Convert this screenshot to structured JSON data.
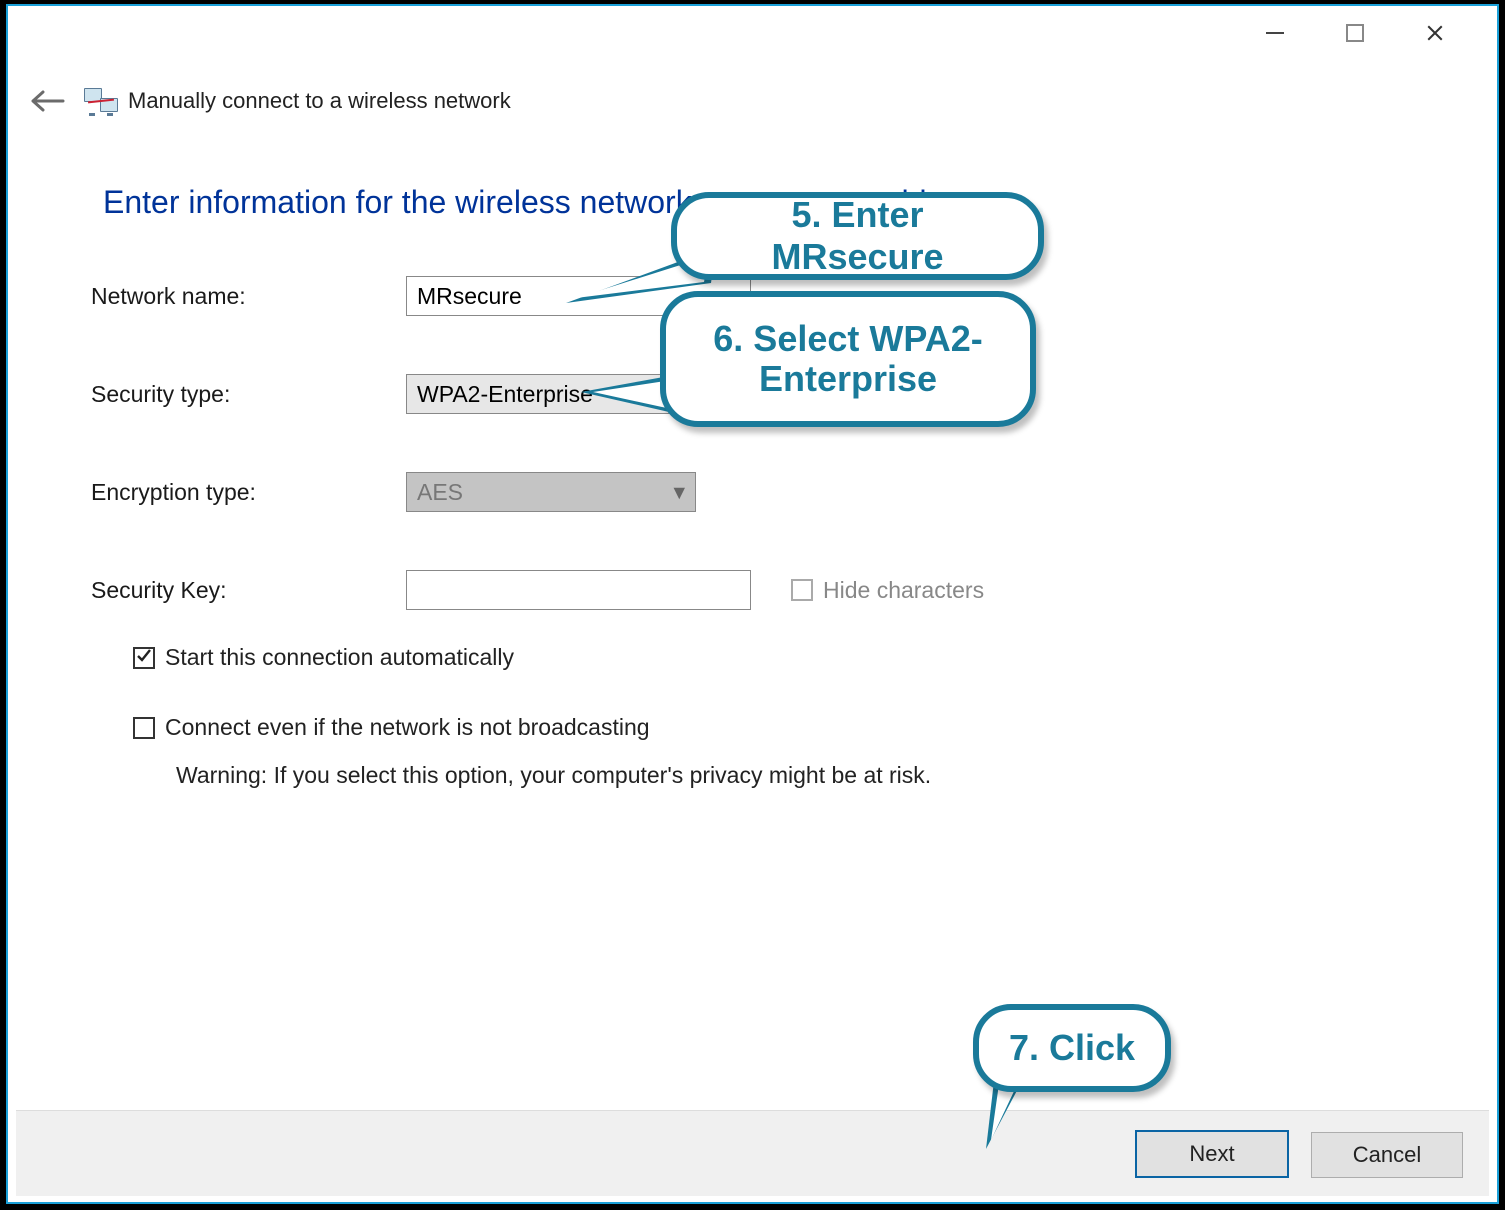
{
  "window": {
    "title": "Manually connect to a wireless network",
    "instruction": "Enter information for the wireless network you want to add"
  },
  "form": {
    "network_name_label": "Network name:",
    "network_name_value": "MRsecure",
    "security_type_label": "Security type:",
    "security_type_value": "WPA2-Enterprise",
    "encryption_type_label": "Encryption type:",
    "encryption_type_value": "AES",
    "security_key_label": "Security Key:",
    "security_key_value": "",
    "hide_characters_label": "Hide characters",
    "hide_characters_checked": false,
    "hide_characters_enabled": false,
    "auto_connect_label": "Start this connection automatically",
    "auto_connect_checked": true,
    "broadcast_label": "Connect even if the network is not broadcasting",
    "broadcast_checked": false,
    "broadcast_warning": "Warning: If you select this option, your computer's privacy might be at risk."
  },
  "buttons": {
    "next": "Next",
    "cancel": "Cancel"
  },
  "callouts": {
    "c5": "5. Enter MRsecure",
    "c6": "6. Select WPA2-Enterprise",
    "c7": "7. Click"
  },
  "colors": {
    "accent": "#1a7a9a",
    "heading": "#003399"
  }
}
